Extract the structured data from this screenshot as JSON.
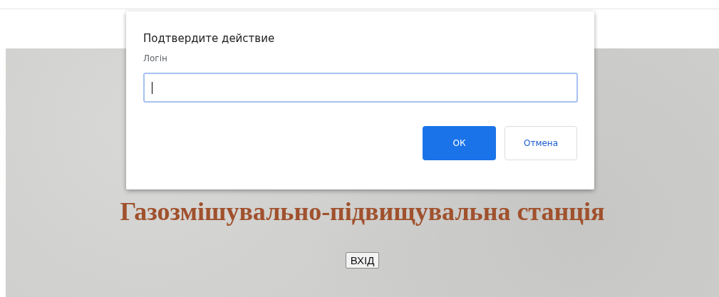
{
  "page": {
    "title": "Газозмішувально-підвищувальна станція",
    "login_button": "ВХІД"
  },
  "dialog": {
    "title": "Подтвердите действие",
    "field_label": "Логін",
    "input": {
      "focused": true
    },
    "buttons": [
      {
        "label": "ОК",
        "kind": "primary"
      },
      {
        "label": "Отмена",
        "kind": "secondary"
      }
    ]
  }
}
